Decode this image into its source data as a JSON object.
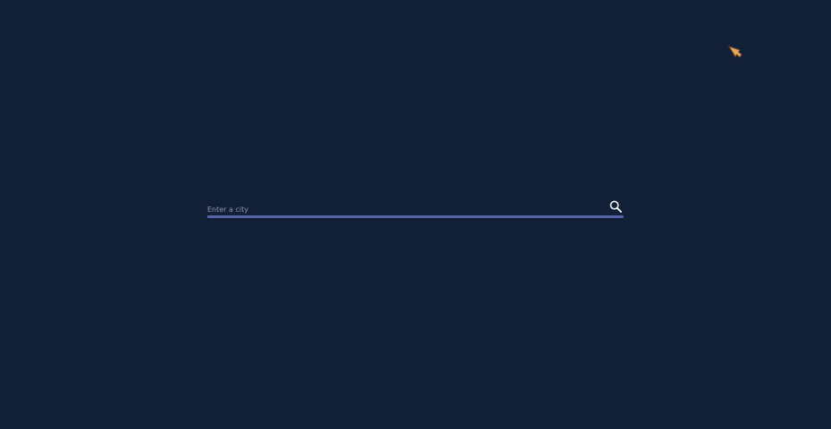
{
  "search": {
    "placeholder": "Enter a city",
    "value": "",
    "icon": "search-icon"
  },
  "cursor": {
    "icon": "hand-pointer-icon"
  },
  "colors": {
    "background": "#112036",
    "underline": "#5364a8",
    "placeholder": "#8a96ad",
    "icon": "#ffffff"
  }
}
